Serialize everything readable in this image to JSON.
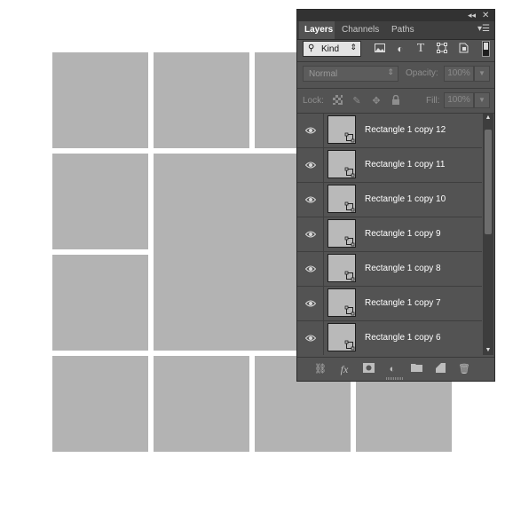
{
  "panel": {
    "tabs": [
      {
        "label": "Layers",
        "active": true
      },
      {
        "label": "Channels",
        "active": false
      },
      {
        "label": "Paths",
        "active": false
      }
    ],
    "collapse_icon": "double-chevron-left-icon",
    "close_icon": "close-icon",
    "menu_icon": "panel-menu-icon"
  },
  "filter": {
    "kind_label": "Kind",
    "icons": [
      "image-filter-icon",
      "adjustment-filter-icon",
      "type-filter-icon",
      "shape-filter-icon",
      "smart-object-filter-icon"
    ]
  },
  "blend": {
    "mode": "Normal",
    "opacity_label": "Opacity:",
    "opacity_value": "100%",
    "lock_label": "Lock:",
    "fill_label": "Fill:",
    "fill_value": "100%"
  },
  "layers": [
    {
      "name": "Rectangle 1 copy 12",
      "visible": true
    },
    {
      "name": "Rectangle 1 copy 11",
      "visible": true
    },
    {
      "name": "Rectangle 1 copy 10",
      "visible": true
    },
    {
      "name": "Rectangle 1 copy 9",
      "visible": true
    },
    {
      "name": "Rectangle 1 copy 8",
      "visible": true
    },
    {
      "name": "Rectangle 1 copy 7",
      "visible": true
    },
    {
      "name": "Rectangle 1 copy 6",
      "visible": true
    }
  ],
  "bottom_icons": [
    "link-layers-icon",
    "fx-icon",
    "layer-mask-icon",
    "adjustment-layer-icon",
    "group-folder-icon",
    "new-layer-icon",
    "trash-icon"
  ],
  "colors": {
    "panel_bg": "#535353",
    "tile_gray": "#b3b3b3",
    "canvas_bg": "#ffffff"
  }
}
